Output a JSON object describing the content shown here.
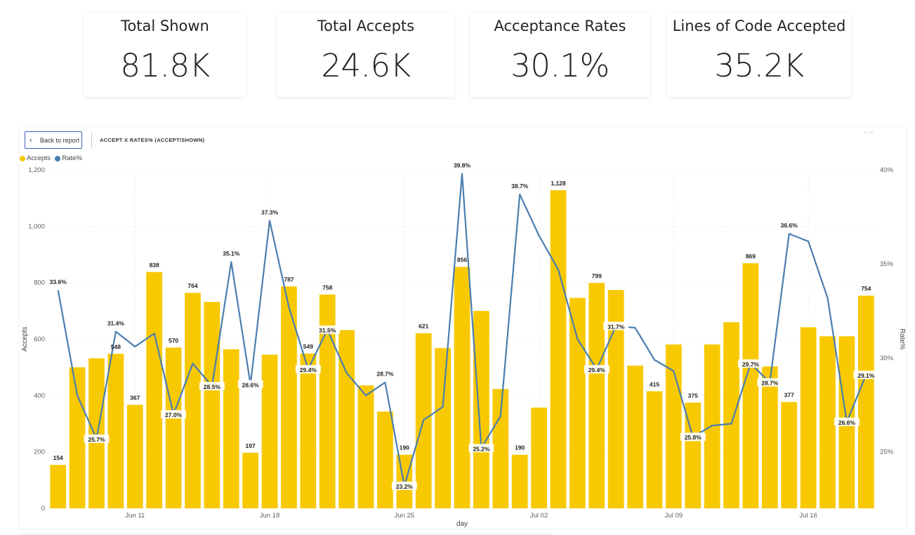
{
  "kpis": [
    {
      "title": "Total Shown",
      "value": "81.8K"
    },
    {
      "title": "Total Accepts",
      "value": "24.6K"
    },
    {
      "title": "Acceptance Rates",
      "value": "30.1%"
    },
    {
      "title": "Lines of Code Accepted",
      "value": "35.2K"
    }
  ],
  "toolbar": {
    "back_label": "Back to report",
    "chart_title": "ACCEPT X RATES% (ACCEPT/SHOWN)",
    "corner_mark": "⌐ ⌐"
  },
  "colors": {
    "accepts": "#F8C900",
    "rate": "#4A7EAE"
  },
  "chart_data": {
    "type": "bar+line",
    "legend": [
      "Accepts",
      "Rate%"
    ],
    "legend_position": "top-left",
    "xlabel": "day",
    "ylabel": "Accepts",
    "y2label": "Rate%",
    "ylim": [
      0,
      1200
    ],
    "y_ticks": [
      "0",
      "200",
      "400",
      "600",
      "800",
      "1,000",
      "1,200"
    ],
    "y2lim": [
      22,
      40
    ],
    "y2_ticks": [
      "25%",
      "30%",
      "35%",
      "40%"
    ],
    "x_tick_labels": [
      {
        "label": "Jun 11",
        "index": 4
      },
      {
        "label": "Jun 18",
        "index": 11
      },
      {
        "label": "Jun 25",
        "index": 18
      },
      {
        "label": "Jul 02",
        "index": 25
      },
      {
        "label": "Jul 09",
        "index": 32
      },
      {
        "label": "Jul 16",
        "index": 39
      }
    ],
    "grid": true,
    "series": [
      {
        "name": "Accepts",
        "type": "bar",
        "values": [
          154,
          500,
          532,
          548,
          367,
          838,
          570,
          764,
          732,
          564,
          197,
          545,
          787,
          549,
          758,
          632,
          436,
          343,
          190,
          621,
          568,
          856,
          700,
          423,
          190,
          357,
          1128,
          746,
          799,
          774,
          506,
          415,
          581,
          375,
          581,
          660,
          869,
          503,
          377,
          642,
          610,
          610,
          754
        ],
        "labels": [
          "154",
          "",
          "",
          "548",
          "367",
          "838",
          "570",
          "764",
          "",
          "",
          "197",
          "",
          "787",
          "549",
          "758",
          "",
          "",
          "",
          "190",
          "621",
          "",
          "856",
          "",
          "",
          "190",
          "",
          "1,128",
          "",
          "799",
          "",
          "",
          "415",
          "",
          "375",
          "",
          "",
          "869",
          "",
          "377",
          "",
          "",
          "",
          "754"
        ]
      },
      {
        "name": "Rate%",
        "type": "line",
        "values": [
          33.6,
          28.0,
          25.7,
          31.4,
          30.6,
          31.3,
          27.0,
          29.7,
          28.5,
          35.1,
          28.6,
          37.3,
          32.7,
          29.4,
          31.5,
          29.2,
          28.0,
          28.7,
          23.2,
          26.7,
          27.4,
          39.8,
          25.2,
          26.9,
          38.7,
          36.5,
          34.7,
          31.0,
          29.4,
          31.7,
          31.6,
          29.9,
          29.3,
          25.8,
          26.4,
          26.5,
          29.7,
          28.7,
          36.6,
          36.2,
          33.2,
          26.6,
          29.1
        ],
        "labels": [
          "33.6%",
          "",
          "25.7%",
          "31.4%",
          "",
          "",
          "27.0%",
          "",
          "28.5%",
          "35.1%",
          "28.6%",
          "37.3%",
          "",
          "29.4%",
          "31.5%",
          "",
          "",
          "28.7%",
          "23.2%",
          "",
          "",
          "39.8%",
          "25.2%",
          "",
          "38.7%",
          "",
          "",
          "",
          "29.4%",
          "31.7%",
          "",
          "",
          "",
          "25.8%",
          "",
          "",
          "29.7%",
          "28.7%",
          "36.6%",
          "",
          "",
          "26.6%",
          "29.1%"
        ],
        "boxed": [
          false,
          false,
          true,
          false,
          false,
          false,
          true,
          false,
          true,
          false,
          true,
          false,
          false,
          true,
          true,
          false,
          false,
          false,
          true,
          false,
          false,
          false,
          true,
          false,
          false,
          false,
          false,
          false,
          true,
          true,
          false,
          false,
          false,
          true,
          false,
          false,
          true,
          true,
          false,
          false,
          false,
          true,
          true
        ]
      }
    ]
  }
}
